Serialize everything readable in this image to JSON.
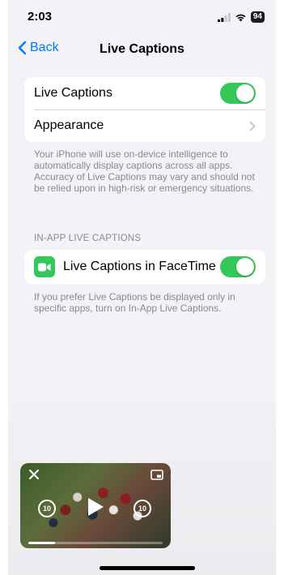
{
  "status_bar": {
    "time": "2:03",
    "battery": "94"
  },
  "nav": {
    "back_label": "Back",
    "title": "Live Captions"
  },
  "main_group": {
    "live_captions_label": "Live Captions",
    "live_captions_on": true,
    "appearance_label": "Appearance"
  },
  "description": "Your iPhone will use on-device intelligence to automatically display captions across all apps. Accuracy of Live Captions may vary and should not be relied upon in high-risk or emergency situations.",
  "in_app": {
    "header": "IN-APP LIVE CAPTIONS",
    "facetime_label": "Live Captions in FaceTime",
    "facetime_on": true,
    "footer": "If you prefer Live Captions be displayed only in specific apps, turn on In-App Live Captions."
  },
  "pip": {
    "skip_back": "10",
    "skip_forward": "10",
    "progress": 0.2
  },
  "colors": {
    "accent": "#007aff",
    "toggle_on": "#34c759",
    "background": "#f2f2f7",
    "secondary_text": "#8a8a8e"
  }
}
